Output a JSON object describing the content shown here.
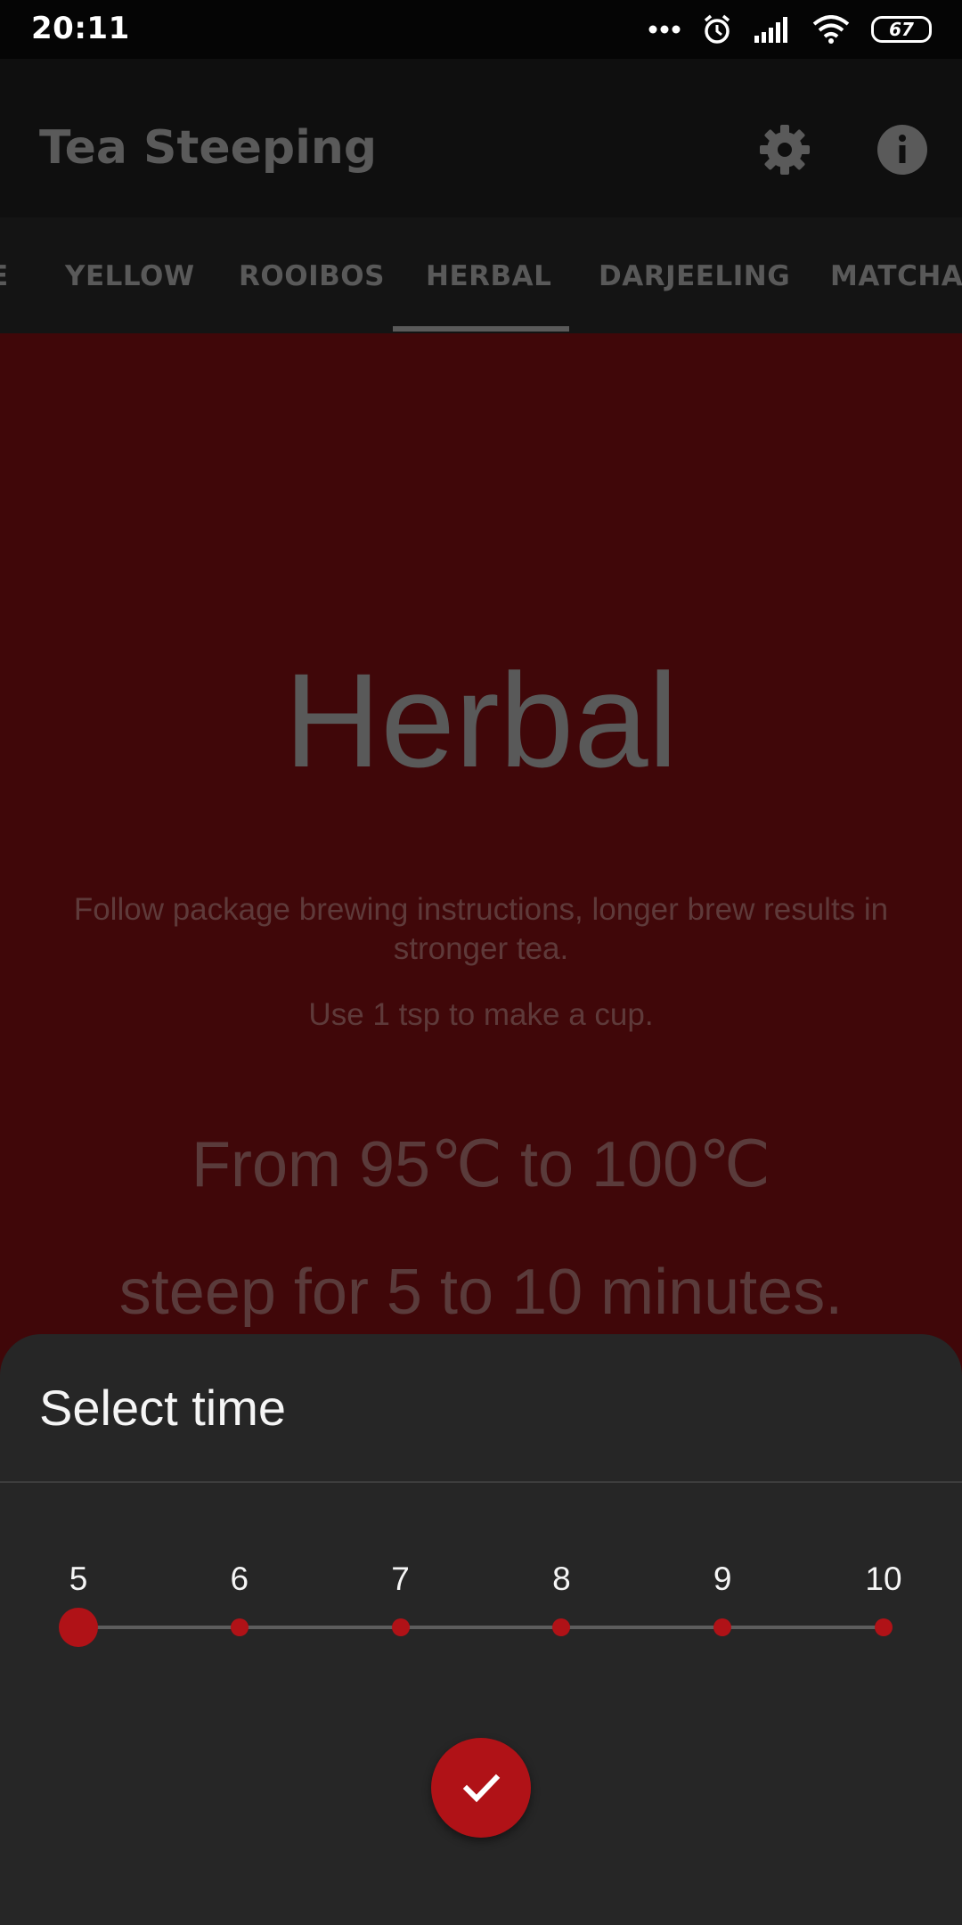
{
  "status_bar": {
    "time": "20:11",
    "battery_level": "67",
    "icons": [
      "more-dots-icon",
      "alarm-icon",
      "signal-icon",
      "wifi-icon",
      "battery-icon"
    ]
  },
  "app_bar": {
    "title": "Tea Steeping",
    "icons": [
      "gear-icon",
      "info-icon"
    ]
  },
  "tabs": {
    "items": [
      {
        "label": "E"
      },
      {
        "label": "YELLOW"
      },
      {
        "label": "ROOIBOS"
      },
      {
        "label": "HERBAL"
      },
      {
        "label": "DARJEELING"
      },
      {
        "label": "MATCHA"
      }
    ],
    "selected": "HERBAL"
  },
  "tea": {
    "name": "Herbal",
    "description": "Follow package brewing instructions, longer brew results in stronger tea.",
    "amount": "Use 1 tsp to make a cup.",
    "temperature": "From 95℃ to 100℃",
    "steep": "steep for 5 to 10 minutes."
  },
  "sheet": {
    "title": "Select time",
    "ticks": [
      "5",
      "6",
      "7",
      "8",
      "9",
      "10"
    ],
    "selected_value": 5,
    "confirm_icon": "check-icon"
  },
  "colors": {
    "accent": "#b01217",
    "background": "#400709",
    "sheet": "#262626"
  }
}
